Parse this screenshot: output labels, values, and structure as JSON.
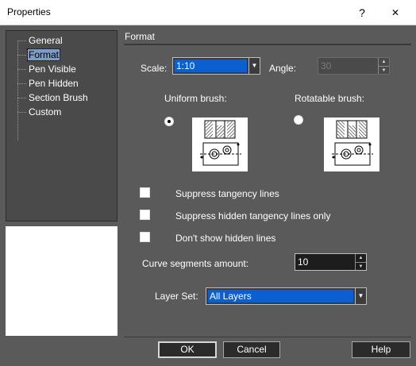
{
  "window": {
    "title": "Properties",
    "help_glyph": "?",
    "close_glyph": "✕"
  },
  "tree": {
    "items": [
      {
        "label": "General",
        "selected": false
      },
      {
        "label": "Format",
        "selected": true
      },
      {
        "label": "Pen Visible",
        "selected": false
      },
      {
        "label": "Pen Hidden",
        "selected": false
      },
      {
        "label": "Section Brush",
        "selected": false
      },
      {
        "label": "Custom",
        "selected": false
      }
    ]
  },
  "format": {
    "header": "Format",
    "scale_label": "Scale:",
    "scale_value": "1:10",
    "angle_label": "Angle:",
    "angle_value": "30",
    "uniform_label": "Uniform brush:",
    "rotatable_label": "Rotatable brush:",
    "uniform_selected": true,
    "rotatable_selected": false,
    "options": [
      {
        "label": "Suppress tangency lines",
        "checked": false
      },
      {
        "label": "Suppress hidden tangency lines only",
        "checked": false
      },
      {
        "label": "Don't show hidden lines",
        "checked": false
      }
    ],
    "curve_label": "Curve segments amount:",
    "curve_value": "10",
    "layer_label": "Layer Set:",
    "layer_value": "All Layers"
  },
  "buttons": {
    "ok": "OK",
    "cancel": "Cancel",
    "help": "Help"
  },
  "colors": {
    "dialog_bg": "#5a5a5a",
    "selection": "#0b5fd0",
    "tree_bg": "#4a4a4a"
  }
}
